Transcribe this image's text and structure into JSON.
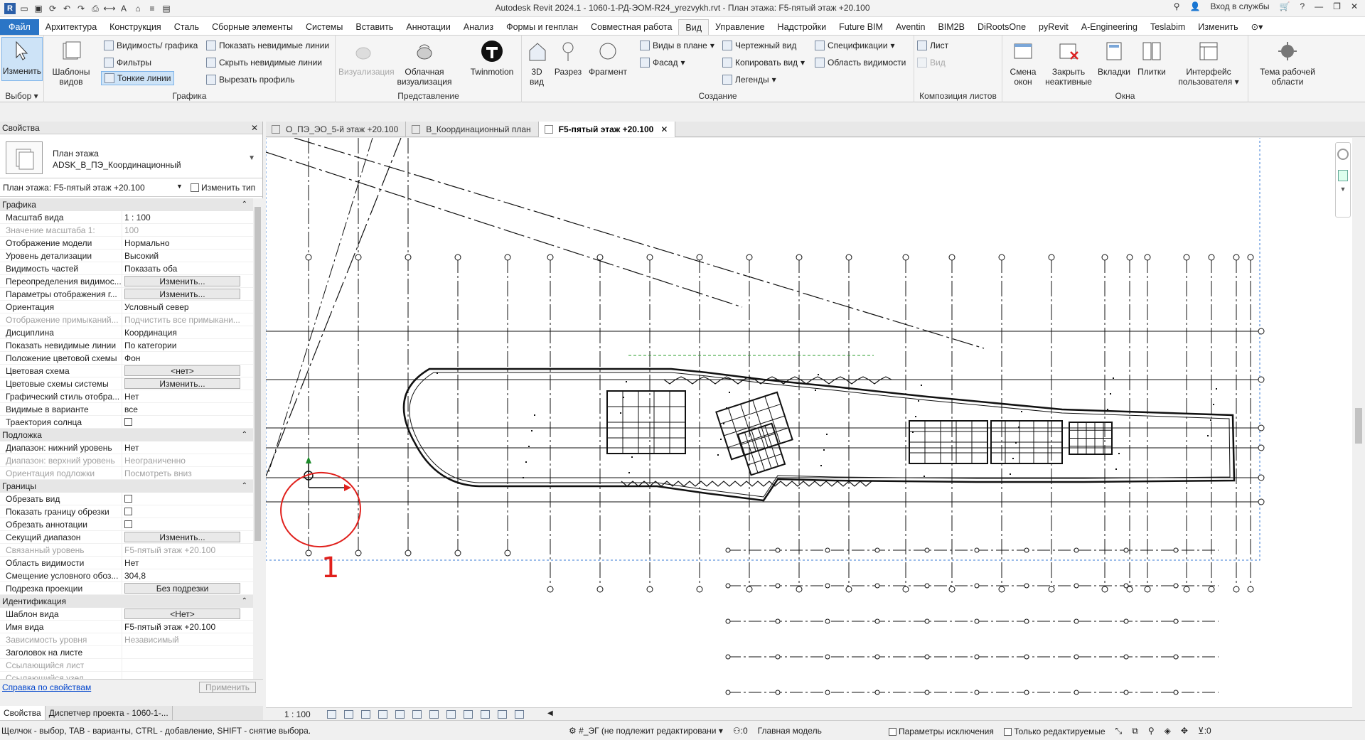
{
  "app_title": "Autodesk Revit 2024.1 - 1060-1-РД-ЭОМ-R24_yrezvykh.rvt - План этажа: F5-пятый этаж +20.100",
  "title_right": {
    "sign_in": "Вход в службы"
  },
  "ribbon_tabs": [
    "Файл",
    "Архитектура",
    "Конструкция",
    "Сталь",
    "Сборные элементы",
    "Системы",
    "Вставить",
    "Аннотации",
    "Анализ",
    "Формы и генплан",
    "Совместная работа",
    "Вид",
    "Управление",
    "Надстройки",
    "Future BIM",
    "Aventin",
    "BIM2B",
    "DiRootsOne",
    "pyRevit",
    "A-Engineering",
    "Teslabim",
    "Изменить"
  ],
  "active_tab": "Вид",
  "ribbon": {
    "select": {
      "modify": "Изменить",
      "title": "Выбор"
    },
    "graphics": {
      "templates": "Шаблоны видов",
      "visibility": "Видимость/ графика",
      "filters": "Фильтры",
      "thin_lines": "Тонкие линии",
      "show_hidden": "Показать невидимые линии",
      "hide_hidden": "Скрыть невидимые линии",
      "cut_profile": "Вырезать профиль",
      "title": "Графика"
    },
    "presentation": {
      "render": "Визуализация",
      "cloud": "Облачная визуализация",
      "twinmotion": "Twinmotion",
      "title": "Представление"
    },
    "create": {
      "view3d": "3D вид",
      "section": "Разрез",
      "callout": "Фрагмент",
      "plan_views": "Виды в плане",
      "elevation": "Фасад",
      "drafting": "Чертежный вид",
      "duplicate": "Копировать вид",
      "legends": "Легенды",
      "schedules": "Спецификации",
      "scope_box": "Область видимости",
      "title": "Создание"
    },
    "sheet": {
      "sheet": "Лист",
      "view": "Вид",
      "title": "Композиция листов"
    },
    "window": {
      "switch": "Смена окон",
      "close_inactive": "Закрыть неактивные",
      "tabs": "Вкладки",
      "tile": "Плитки",
      "ui": "Интерфейс пользователя",
      "title": "Окна"
    },
    "workspace": {
      "theme": "Тема рабочей области"
    }
  },
  "properties": {
    "header": "Свойства",
    "type_line1": "План этажа",
    "type_line2": "ADSK_B_ПЭ_Координационный",
    "instance": "План этажа: F5-пятый этаж +20.100",
    "edit_type": "Изменить тип",
    "groups": [
      {
        "name": "Графика",
        "rows": [
          {
            "k": "Масштаб вида",
            "v": "1 : 100"
          },
          {
            "k": "Значение масштаба    1:",
            "v": "100",
            "dis": true
          },
          {
            "k": "Отображение модели",
            "v": "Нормально"
          },
          {
            "k": "Уровень детализации",
            "v": "Высокий"
          },
          {
            "k": "Видимость частей",
            "v": "Показать оба"
          },
          {
            "k": "Переопределения видимос...",
            "v": "Изменить...",
            "btn": true
          },
          {
            "k": "Параметры отображения г...",
            "v": "Изменить...",
            "btn": true
          },
          {
            "k": "Ориентация",
            "v": "Условный север"
          },
          {
            "k": "Отображение примыканий...",
            "v": "Подчистить все примыкани...",
            "dis": true
          },
          {
            "k": "Дисциплина",
            "v": "Координация"
          },
          {
            "k": "Показать невидимые линии",
            "v": "По категории"
          },
          {
            "k": "Положение цветовой схемы",
            "v": "Фон"
          },
          {
            "k": "Цветовая схема",
            "v": "<нет>",
            "btn": true
          },
          {
            "k": "Цветовые схемы системы",
            "v": "Изменить...",
            "btn": true
          },
          {
            "k": "Графический стиль отобра...",
            "v": "Нет"
          },
          {
            "k": "Видимые в варианте",
            "v": "все"
          },
          {
            "k": "Траектория солнца",
            "v": "",
            "cb": true
          }
        ]
      },
      {
        "name": "Подложка",
        "rows": [
          {
            "k": "Диапазон: нижний уровень",
            "v": "Нет"
          },
          {
            "k": "Диапазон: верхний уровень",
            "v": "Неограниченно",
            "dis": true
          },
          {
            "k": "Ориентация подложки",
            "v": "Посмотреть вниз",
            "dis": true
          }
        ]
      },
      {
        "name": "Границы",
        "rows": [
          {
            "k": "Обрезать вид",
            "v": "",
            "cb": true
          },
          {
            "k": "Показать границу обрезки",
            "v": "",
            "cb": true
          },
          {
            "k": "Обрезать аннотации",
            "v": "",
            "cb": true
          },
          {
            "k": "Секущий диапазон",
            "v": "Изменить...",
            "btn": true
          },
          {
            "k": "Связанный уровень",
            "v": "F5-пятый этаж +20.100",
            "dis": true
          },
          {
            "k": "Область видимости",
            "v": "Нет"
          },
          {
            "k": "Смещение условного обоз...",
            "v": "304,8"
          },
          {
            "k": "Подрезка проекции",
            "v": "Без подрезки",
            "btn": true
          }
        ]
      },
      {
        "name": "Идентификация",
        "rows": [
          {
            "k": "Шаблон вида",
            "v": "<Нет>",
            "btn": true
          },
          {
            "k": "Имя вида",
            "v": "F5-пятый этаж +20.100"
          },
          {
            "k": "Зависимость уровня",
            "v": "Независимый",
            "dis": true
          },
          {
            "k": "Заголовок на листе",
            "v": ""
          },
          {
            "k": "Ссылающийся лист",
            "v": "",
            "dis": true
          },
          {
            "k": "Ссылающийся узел",
            "v": "",
            "dis": true
          }
        ]
      }
    ],
    "help": "Справка по свойствам",
    "apply": "Применить"
  },
  "bottom_tabs": [
    "Свойства",
    "Диспетчер проекта - 1060-1-..."
  ],
  "doc_tabs": [
    {
      "label": "О_ПЭ_ЭО_5-й этаж +20.100",
      "active": false
    },
    {
      "label": "В_Координационный план",
      "active": false
    },
    {
      "label": "F5-пятый этаж +20.100",
      "active": true
    }
  ],
  "annotation_label": "1",
  "view_scale": "1 : 100",
  "status": {
    "message": "Щелчок - выбор, TAB - варианты, CTRL - добавление, SHIFT - снятие выбора.",
    "workset": "#_ЭГ (не подлежит редактировани",
    "count": ":0",
    "model": "Главная модель",
    "exclusions": "Параметры исключения",
    "editable_only": "Только редактируемые",
    "filter_count": ":0"
  },
  "colors": {
    "file_tab": "#2b75c6",
    "annotation": "#e0201c",
    "crop": "#3a7bd5"
  }
}
